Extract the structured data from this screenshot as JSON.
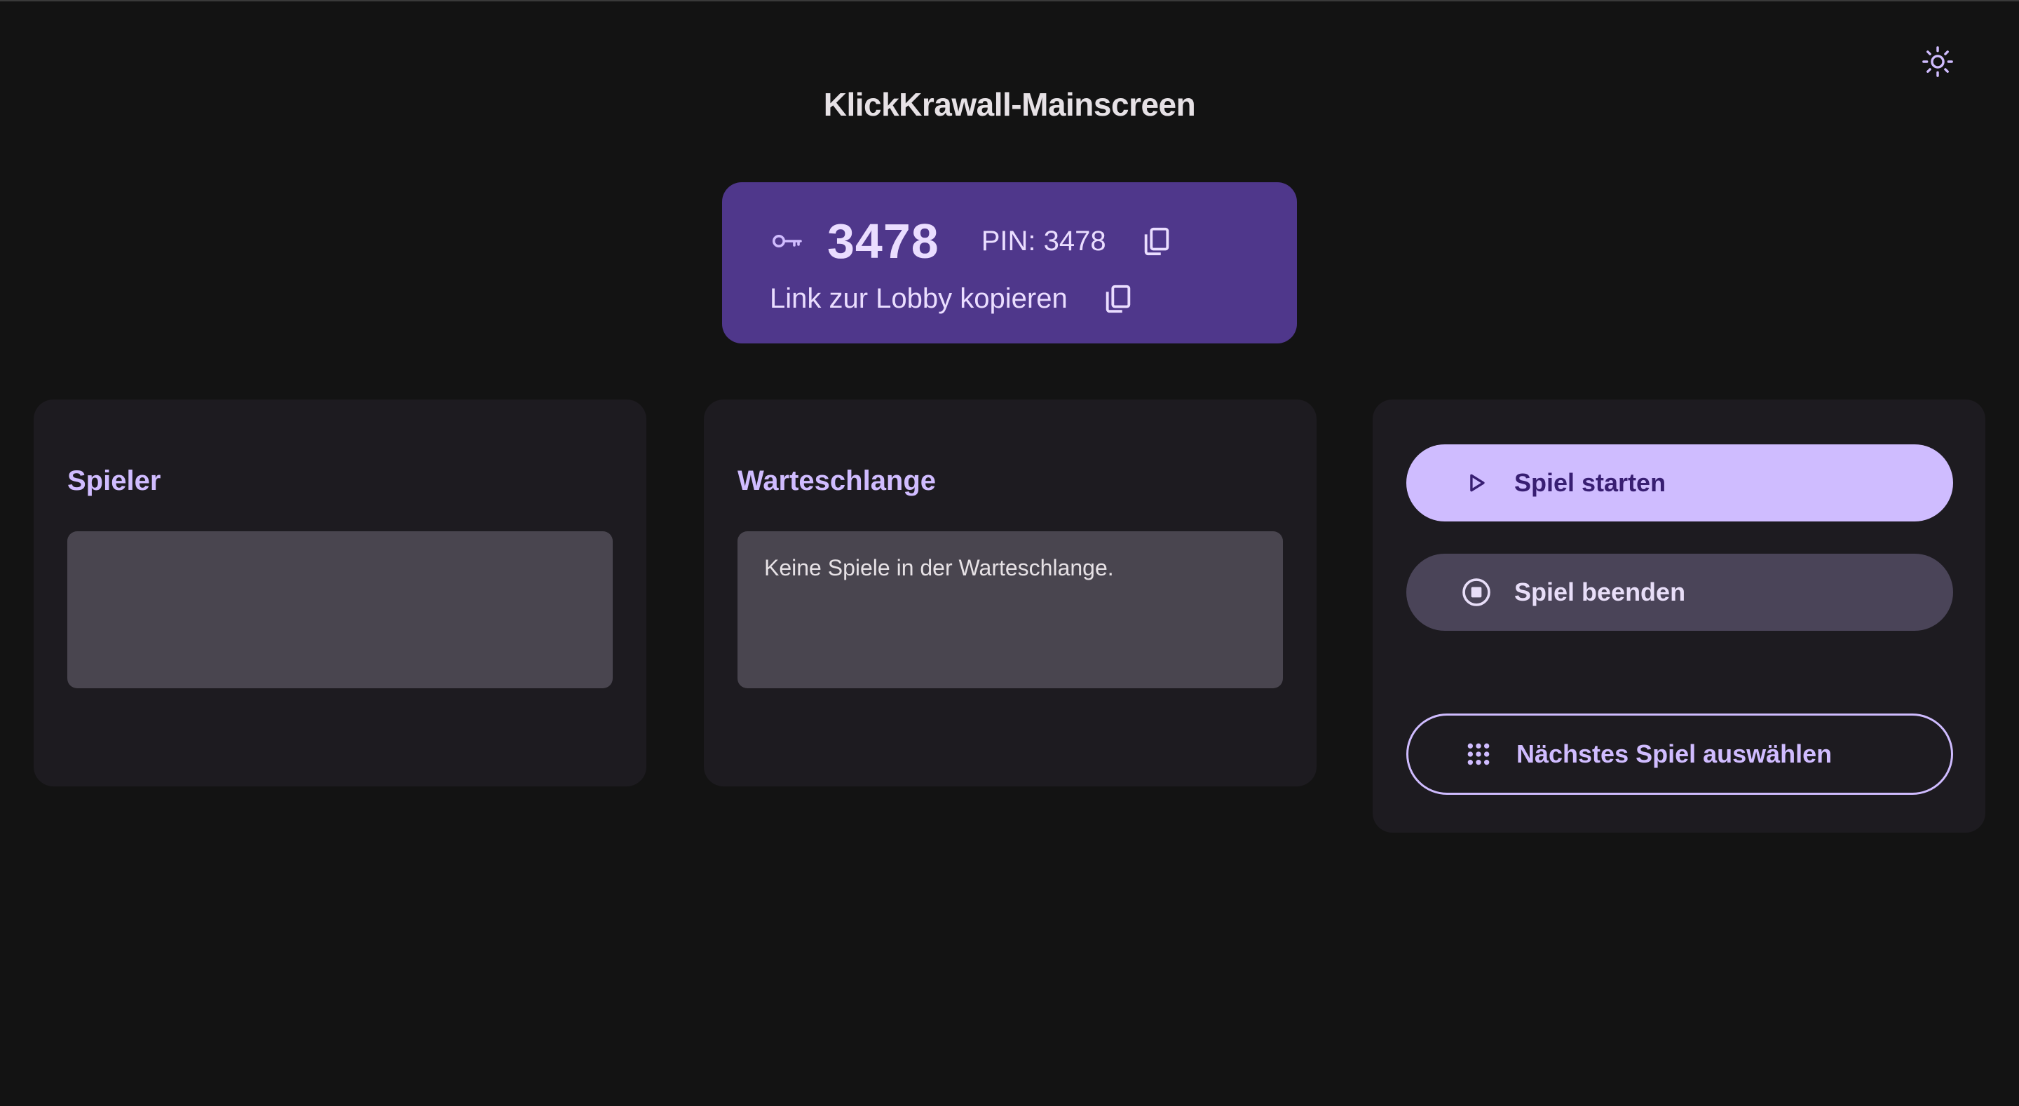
{
  "app": {
    "title": "KlickKrawall-Mainscreen",
    "theme_toggle_icon": "sun-icon"
  },
  "lobby": {
    "pin_icon": "key-icon",
    "pin_value": "3478",
    "pin_label": "PIN: 3478",
    "copy_pin_icon": "copy-icon",
    "link_label": "Link zur Lobby kopieren",
    "copy_link_icon": "copy-icon"
  },
  "players": {
    "title": "Spieler",
    "items": []
  },
  "queue": {
    "title": "Warteschlange",
    "empty_text": "Keine Spiele in der Warteschlange."
  },
  "controls": {
    "start_label": "Spiel starten",
    "start_icon": "play-icon",
    "stop_label": "Spiel beenden",
    "stop_icon": "stop-circle-icon",
    "next_label": "Nächstes Spiel auswählen",
    "next_icon": "grid-dots-icon"
  },
  "colors": {
    "background": "#131313",
    "surface": "#1d1b20",
    "pin_card": "#4f378b",
    "primary": "#cfbcff",
    "on_primary": "#381e72",
    "secondary_container": "#4a4458",
    "box": "#49454f"
  }
}
